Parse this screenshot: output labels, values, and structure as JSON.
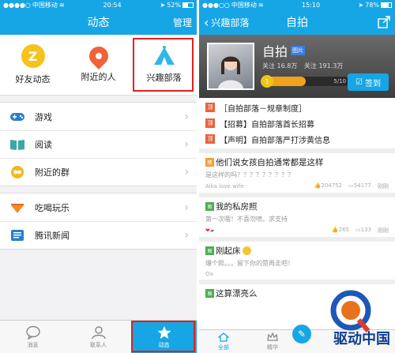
{
  "left": {
    "status": {
      "carrier": "中国移动",
      "time": "20:54",
      "battery": "52%"
    },
    "nav": {
      "title": "动态",
      "right": "管理"
    },
    "top_icons": [
      {
        "label": "好友动态",
        "icon": "qzone-star-icon",
        "color": "#f6c21c"
      },
      {
        "label": "附近的人",
        "icon": "location-pin-icon",
        "color": "#f0623a"
      },
      {
        "label": "兴趣部落",
        "icon": "tent-icon",
        "color": "#2fb7e8"
      }
    ],
    "menu1": [
      {
        "label": "游戏",
        "icon": "gamepad-icon"
      },
      {
        "label": "阅读",
        "icon": "book-icon"
      },
      {
        "label": "附近的群",
        "icon": "group-icon"
      }
    ],
    "menu2": [
      {
        "label": "吃喝玩乐",
        "icon": "food-icon"
      },
      {
        "label": "腾讯新闻",
        "icon": "news-icon"
      }
    ],
    "tabs": [
      {
        "label": "消息",
        "icon": "message-icon"
      },
      {
        "label": "联系人",
        "icon": "contacts-icon"
      },
      {
        "label": "动态",
        "icon": "star-icon"
      }
    ]
  },
  "right": {
    "status": {
      "carrier": "中国移动",
      "time": "15:10",
      "battery": "78%"
    },
    "nav": {
      "back": "兴趣部落",
      "title": "自拍"
    },
    "banner": {
      "title": "自拍",
      "tag": "图片",
      "stat_follow_label": "关注",
      "stat_follow": "16.8万",
      "stat_posts_label": "关注",
      "stat_posts": "191.3万",
      "level": "1",
      "progress_text": "5/10",
      "progress_fraction": 0.5,
      "checkin": "签到"
    },
    "sticky": [
      {
        "tag": "顶",
        "text": "［自拍部落－规章制度］"
      },
      {
        "tag": "顶",
        "text": "【招募】自拍部落酋长招募"
      },
      {
        "tag": "顶",
        "text": "【声明】自拍部落严打涉黄信息"
      }
    ],
    "posts": [
      {
        "tag": "精",
        "title": "他们说女孩自拍通常都是这样",
        "excerpt": "是这样的吗？？？？？？？？？",
        "author": "Aika love wife",
        "likes": "204752",
        "comments": "54177",
        "time": "刚刚"
      },
      {
        "tag": "图",
        "title": "我的私房照",
        "excerpt": "第一次哦！不喜勿喷。求支持",
        "author": "",
        "likes": "265",
        "comments": "133",
        "time": "刚刚"
      },
      {
        "tag": "图",
        "title": "刚起床",
        "excerpt": "爆个照。。。留下你的赞再走吧！",
        "author": "Oa",
        "likes": "",
        "comments": "",
        "time": ""
      },
      {
        "tag": "图",
        "title": "这算漂亮么",
        "excerpt": "",
        "author": "",
        "likes": "",
        "comments": "",
        "time": ""
      }
    ],
    "tabs": [
      {
        "label": "全部"
      },
      {
        "label": "精华"
      },
      {
        "label": ""
      }
    ],
    "watermark": "驱动中国"
  }
}
